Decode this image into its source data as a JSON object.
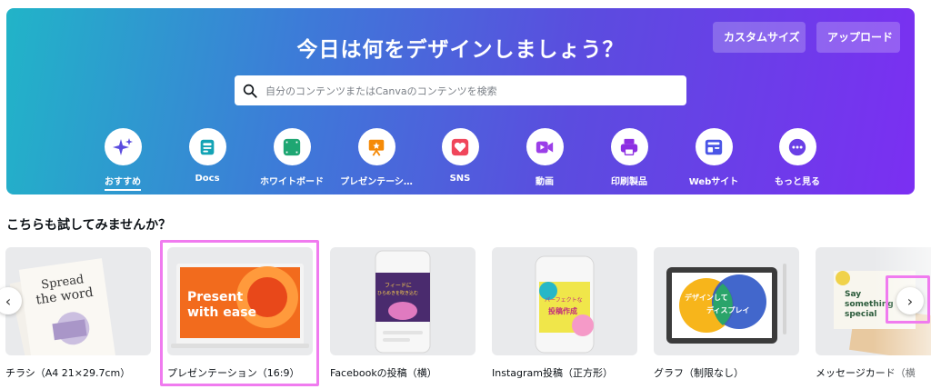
{
  "hero": {
    "title": "今日は何をデザインしましょう？",
    "custom_size": "カスタムサイズ",
    "upload": "アップロード",
    "search_placeholder": "自分のコンテンツまたはCanvaのコンテンツを検索",
    "gradient": [
      "#21b4c8",
      "#5b4cdf",
      "#7b2ff2"
    ]
  },
  "categories": [
    {
      "label": "おすすめ",
      "icon": "sparkle-icon",
      "color": "#5b4cdf",
      "active": true
    },
    {
      "label": "Docs",
      "icon": "doc-icon",
      "color": "#13a3b5"
    },
    {
      "label": "ホワイトボード",
      "icon": "whiteboard-icon",
      "color": "#1ea672"
    },
    {
      "label": "プレゼンテーシ…",
      "icon": "presentation-icon",
      "color": "#f58a07"
    },
    {
      "label": "SNS",
      "icon": "heart-icon",
      "color": "#f0465b"
    },
    {
      "label": "動画",
      "icon": "video-icon",
      "color": "#9b3fe8"
    },
    {
      "label": "印刷製品",
      "icon": "printer-icon",
      "color": "#8d2fe2"
    },
    {
      "label": "Webサイト",
      "icon": "website-icon",
      "color": "#4a55e6"
    },
    {
      "label": "もっと見る",
      "icon": "more-icon",
      "color": "#6a3fe6"
    }
  ],
  "section": {
    "title": "こちらも試してみませんか？"
  },
  "cards": [
    {
      "label": "チラシ（A4 21×29.7cm）",
      "thumb_text": [
        "Spread",
        "the word"
      ]
    },
    {
      "label": "プレゼンテーション（16:9）",
      "thumb_text": [
        "Present",
        "with ease"
      ]
    },
    {
      "label": "Facebookの投稿（横）",
      "thumb_text": [
        "フィードに",
        "ひらめきを吹き込む"
      ]
    },
    {
      "label": "Instagram投稿（正方形）",
      "thumb_text": [
        "パーフェクトな",
        "投稿作成"
      ]
    },
    {
      "label": "グラフ（制限なし）",
      "thumb_text": [
        "デザインして",
        "ディスプレイ"
      ]
    },
    {
      "label": "メッセージカード（横",
      "thumb_text": [
        "Say",
        "something",
        "special"
      ]
    }
  ],
  "nav": {
    "prev": "‹",
    "next": "›"
  }
}
